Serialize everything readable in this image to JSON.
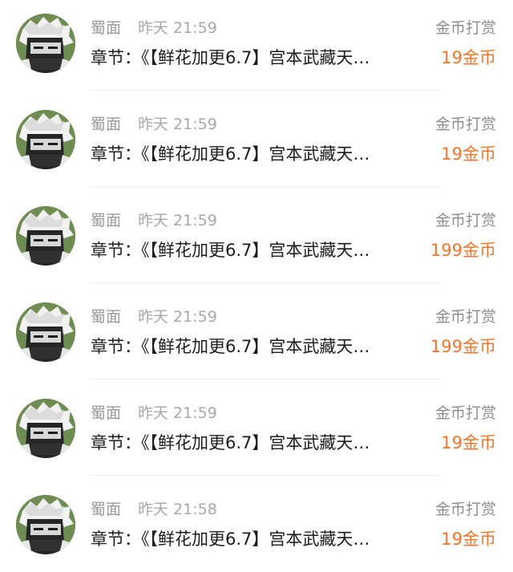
{
  "records": [
    {
      "name": "蜀面",
      "time": "昨天 21:59",
      "tag": "金币打赏",
      "chapter": "章节：《【鲜花加更6.7】宫本武藏天…",
      "amount": "19金币"
    },
    {
      "name": "蜀面",
      "time": "昨天 21:59",
      "tag": "金币打赏",
      "chapter": "章节：《【鲜花加更6.7】宫本武藏天…",
      "amount": "19金币"
    },
    {
      "name": "蜀面",
      "time": "昨天 21:59",
      "tag": "金币打赏",
      "chapter": "章节：《【鲜花加更6.7】宫本武藏天…",
      "amount": "199金币"
    },
    {
      "name": "蜀面",
      "time": "昨天 21:59",
      "tag": "金币打赏",
      "chapter": "章节：《【鲜花加更6.7】宫本武藏天…",
      "amount": "199金币"
    },
    {
      "name": "蜀面",
      "time": "昨天 21:59",
      "tag": "金币打赏",
      "chapter": "章节：《【鲜花加更6.7】宫本武藏天…",
      "amount": "19金币"
    },
    {
      "name": "蜀面",
      "time": "昨天 21:58",
      "tag": "金币打赏",
      "chapter": "章节：《【鲜花加更6.7】宫本武藏天…",
      "amount": "19金币"
    }
  ],
  "colors": {
    "amount": "#f0752b",
    "meta": "#a8a8a8",
    "title": "#1c1c1c"
  },
  "icons": {
    "avatar": "anime-avatar-icon"
  }
}
